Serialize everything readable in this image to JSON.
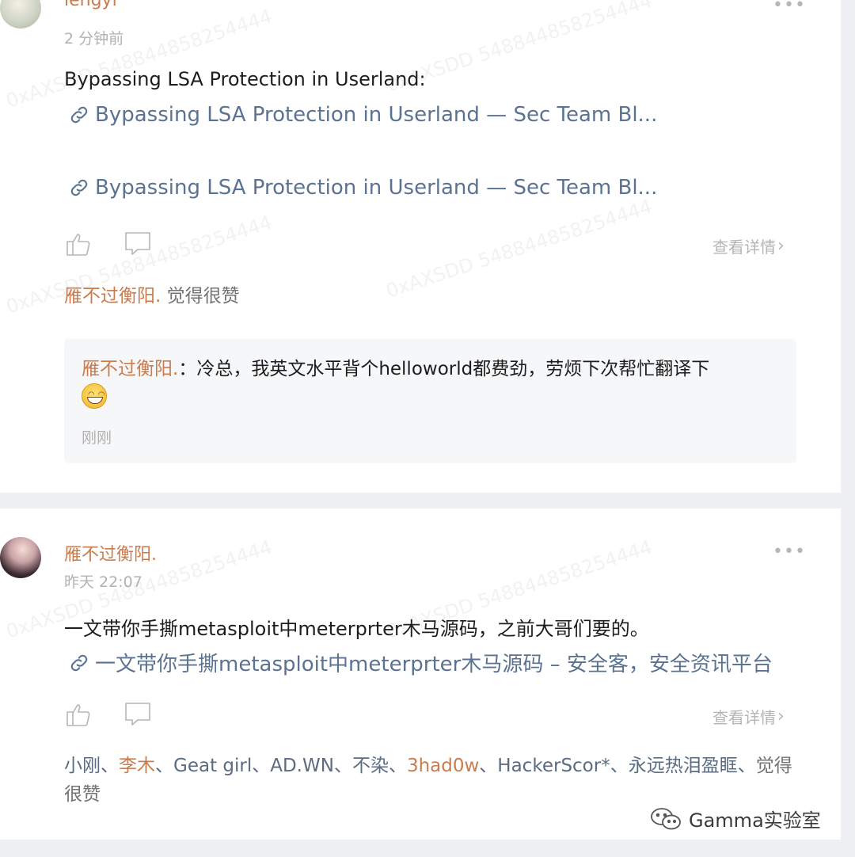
{
  "comments": [
    {
      "author": "lengyi",
      "time": "2 分钟前",
      "text": "Bypassing LSA Protection in Userland:",
      "links": [
        "Bypassing LSA Protection in Userland — Sec Team Bl...",
        "Bypassing LSA Protection in Userland — Sec Team Bl..."
      ],
      "details_label": "查看详情",
      "likes_user": "雁不过衡阳.",
      "likes_suffix": " 觉得很赞",
      "reply": {
        "author": "雁不过衡阳.",
        "text": "：冷总，我英文水平背个helloworld都费劲，劳烦下次帮忙翻译下",
        "emoji": "grinning-face",
        "time": "刚刚"
      }
    },
    {
      "author": "雁不过衡阳.",
      "time": "昨天 22:07",
      "text": "一文带你手撕metasploit中meterprter木马源码，之前大哥们要的。",
      "link": "一文带你手撕metasploit中meterprter木马源码 – 安全客，安全资讯平台",
      "details_label": "查看详情",
      "likes": {
        "u1": "小刚",
        "u2": "李木",
        "u3": "Geat girl",
        "u4": "AD.WN",
        "u5": "不染",
        "u6": "3had0w",
        "u7": "HackerScor*",
        "u8": "永远热泪盈眶",
        "sep": "、",
        "suffix": "觉得很赞"
      }
    }
  ],
  "watermark": "0xAXSDD 548844858254444",
  "footer": {
    "brand": "Gamma实验室",
    "icon": "wechat-icon"
  },
  "colors": {
    "author": "#c97d4e",
    "link": "#5b7391",
    "muted": "#b2b2b2"
  }
}
